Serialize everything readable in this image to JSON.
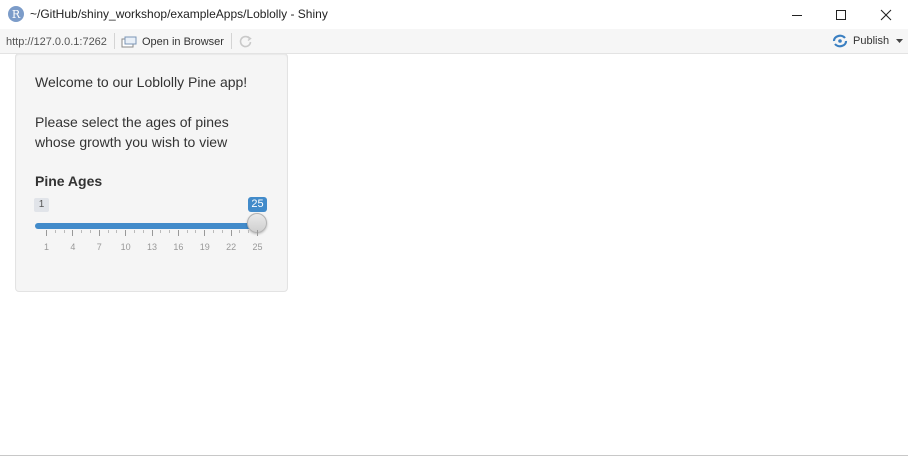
{
  "window": {
    "app_icon_letter": "R",
    "title": "~/GitHub/shiny_workshop/exampleApps/Loblolly - Shiny"
  },
  "toolbar": {
    "url": "http://127.0.0.1:7262",
    "open_in_browser": "Open in Browser",
    "publish": "Publish"
  },
  "panel": {
    "welcome": "Welcome to our Loblolly Pine app!",
    "instructions": "Please select the ages of pines whose growth you wish to view",
    "slider": {
      "label": "Pine Ages",
      "min": 1,
      "max": 25,
      "value": 25,
      "min_label": "1",
      "value_label": "25",
      "tick_labels": [
        "1",
        "4",
        "7",
        "10",
        "13",
        "16",
        "19",
        "22",
        "25"
      ]
    }
  },
  "colors": {
    "accent": "#428bca",
    "panel_bg": "#f5f5f5",
    "publish_icon": "#3a7fc1"
  },
  "icons": {
    "minimize": "minimize-icon",
    "maximize": "maximize-icon",
    "close": "close-icon",
    "open_in_browser": "open-browser-icon",
    "refresh": "refresh-icon",
    "publish": "publish-icon",
    "caret": "chevron-down-icon"
  }
}
